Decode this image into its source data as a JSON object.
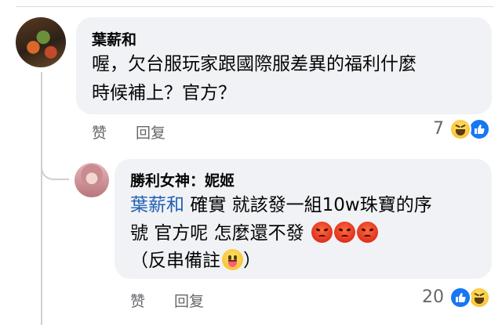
{
  "comment1": {
    "author": "葉薪和",
    "text_line1": "喔，欠台服玩家跟國際服差異的福利什麼",
    "text_line2": "時候補上？官方？",
    "like_label": "赞",
    "reply_label": "回复",
    "reaction_count": "7",
    "reactions": [
      "haha",
      "like"
    ]
  },
  "comment2": {
    "author": "勝利女神：妮姬",
    "mention": "葉薪和",
    "text_line1_rest": " 確實 就該發一組10w珠寶的序",
    "text_line2": "號 官方呢 怎麼還不發 ",
    "text_line3": "（反串備註",
    "text_line3_end": "）",
    "like_label": "赞",
    "reply_label": "回复",
    "reaction_count": "20",
    "reactions": [
      "like",
      "haha"
    ]
  },
  "colors": {
    "bubble": "#f0f2f5",
    "mention": "#1f5fb4",
    "meta_text": "#65676b",
    "like_blue": "#1877f2"
  }
}
